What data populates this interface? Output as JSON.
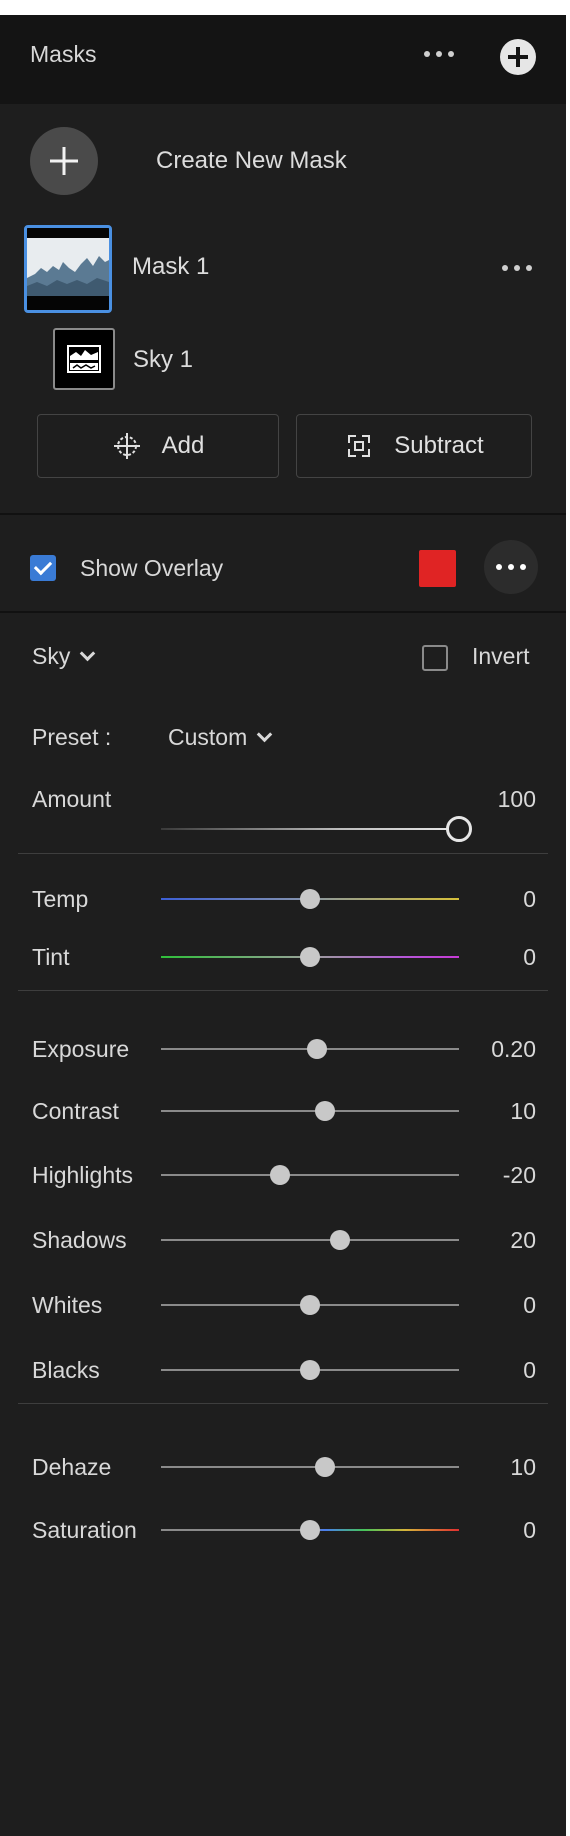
{
  "header": {
    "title": "Masks",
    "more_icon": "ellipsis-icon",
    "add_icon": "plus-circle-icon"
  },
  "create_mask": {
    "label": "Create New Mask"
  },
  "masks": [
    {
      "name": "Mask 1",
      "selected": true
    },
    {
      "name": "Sky 1"
    }
  ],
  "actions": {
    "add_label": "Add",
    "subtract_label": "Subtract"
  },
  "overlay": {
    "label": "Show Overlay",
    "checked": true,
    "color": "#e02424"
  },
  "mask_type": {
    "label": "Sky",
    "invert_label": "Invert",
    "invert_checked": false
  },
  "preset": {
    "label": "Preset :",
    "value": "Custom"
  },
  "amount": {
    "label": "Amount",
    "value": "100",
    "level": 100
  },
  "color_sliders": [
    {
      "label": "Temp",
      "value": "0",
      "level": 0
    },
    {
      "label": "Tint",
      "value": "0",
      "level": 0
    }
  ],
  "light_sliders": [
    {
      "label": "Exposure",
      "value": "0.20",
      "level": 0.2
    },
    {
      "label": "Contrast",
      "value": "10",
      "level": 10
    },
    {
      "label": "Highlights",
      "value": "-20",
      "level": -20
    },
    {
      "label": "Shadows",
      "value": "20",
      "level": 20
    },
    {
      "label": "Whites",
      "value": "0",
      "level": 0
    },
    {
      "label": "Blacks",
      "value": "0",
      "level": 0
    }
  ],
  "effect_sliders": [
    {
      "label": "Dehaze",
      "value": "10",
      "level": 10
    },
    {
      "label": "Saturation",
      "value": "0",
      "level": 0
    }
  ],
  "colors": {
    "accent": "#3a7bd5",
    "panel_bg": "#1e1e1e",
    "header_bg": "#141414"
  }
}
